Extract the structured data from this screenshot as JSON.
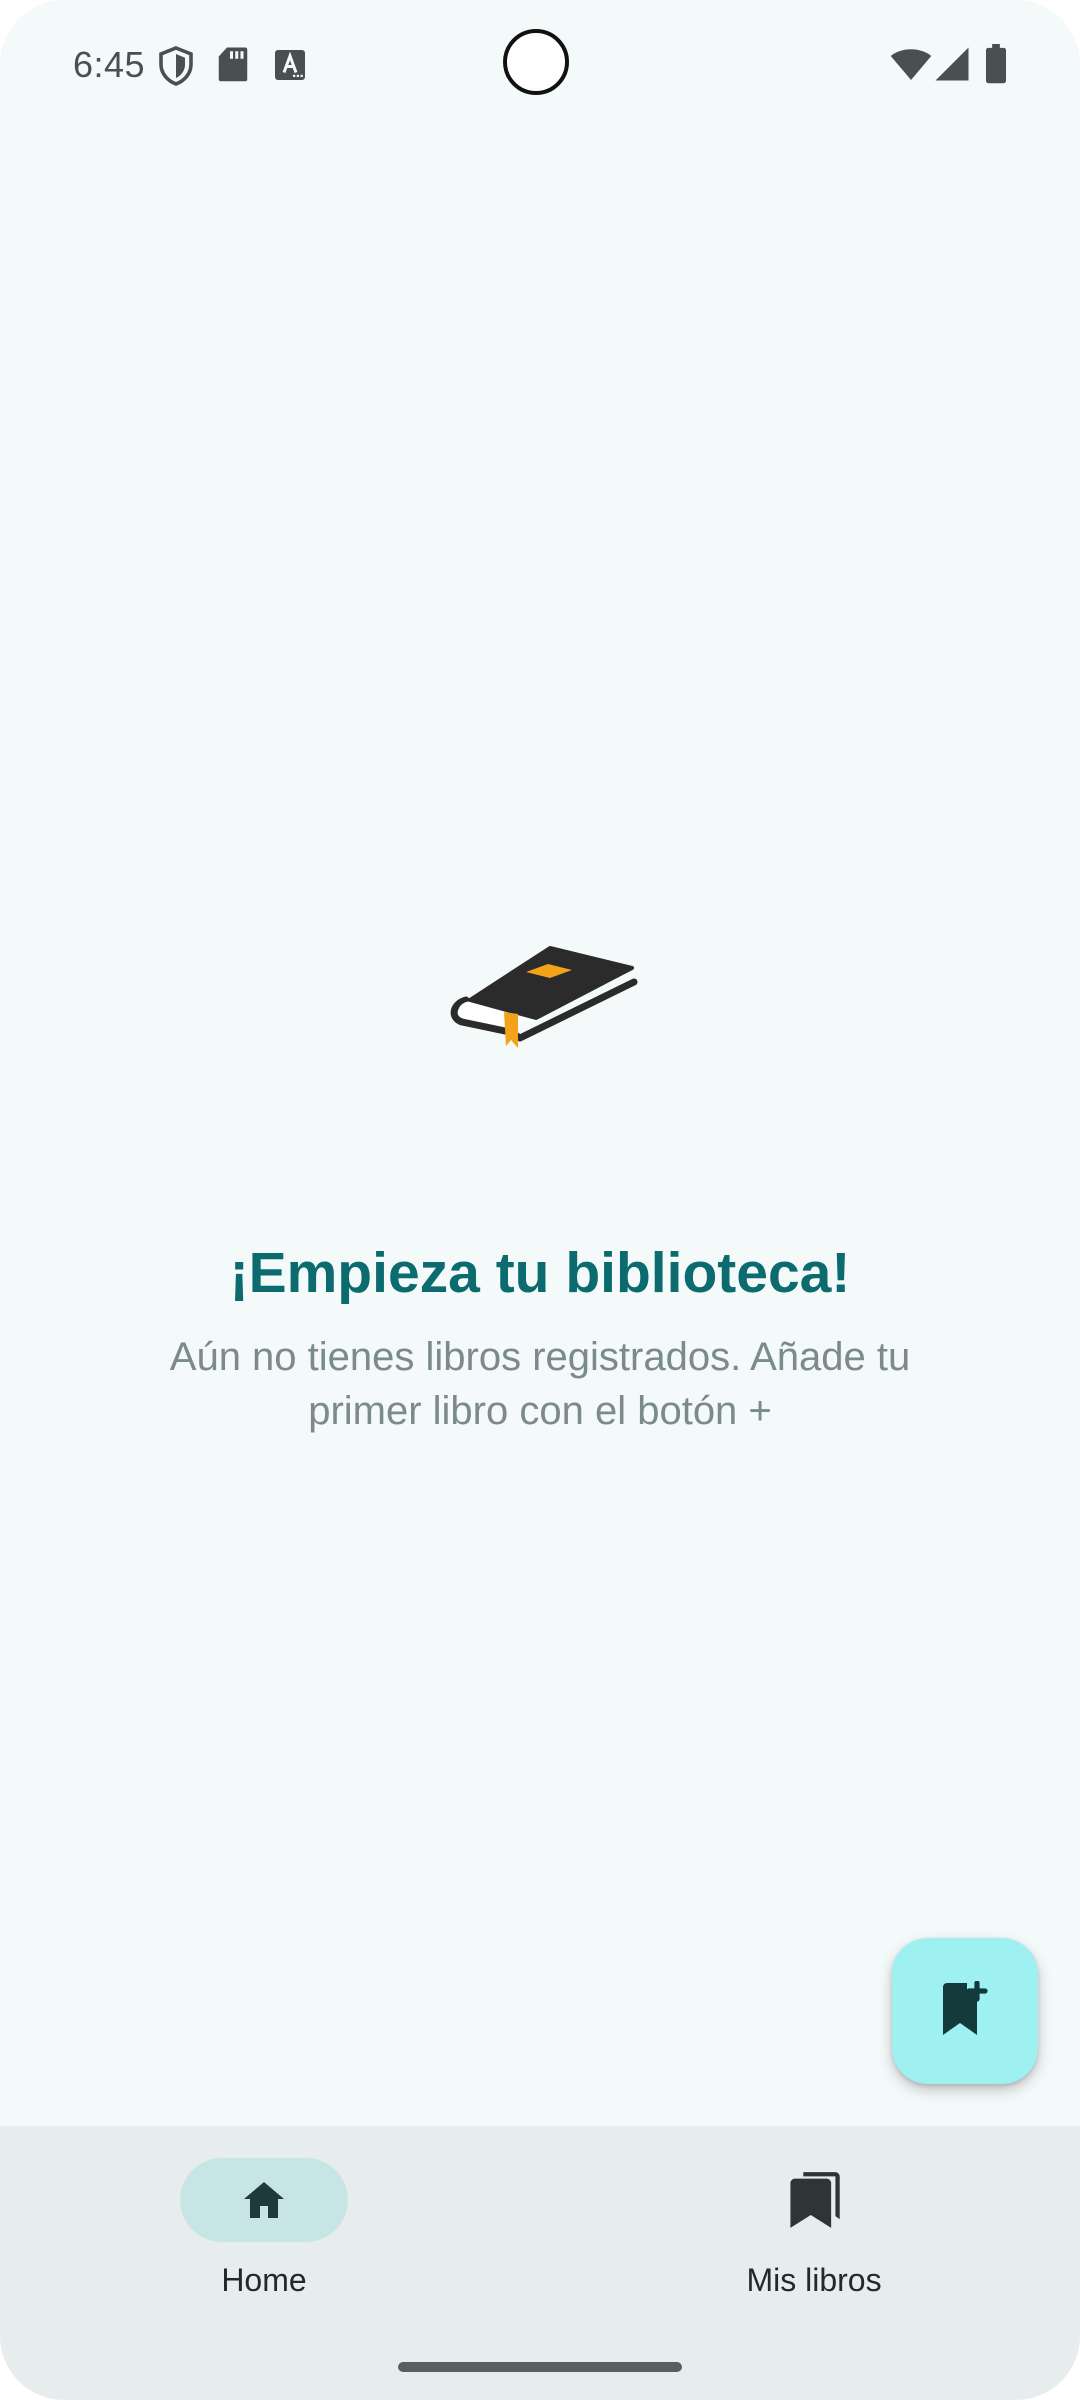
{
  "status_bar": {
    "time": "6:45",
    "left_icons": [
      "shield-icon",
      "sd-card-icon",
      "keyboard-a-icon"
    ],
    "right_icons": [
      "wifi-icon",
      "signal-icon",
      "battery-icon"
    ]
  },
  "empty_state": {
    "illustration": "book-icon",
    "title": "¡Empieza tu biblioteca!",
    "subtitle": "Aún no tienes libros registrados. Añade tu primer libro con el botón +"
  },
  "fab": {
    "icon": "bookmark-add-icon"
  },
  "bottom_nav": {
    "items": [
      {
        "label": "Home",
        "icon": "home-icon",
        "active": true
      },
      {
        "label": "Mis libros",
        "icon": "bookmarks-icon",
        "active": false
      }
    ]
  },
  "colors": {
    "background": "#f4f9f9",
    "accent_title": "#0b6b6f",
    "fab": "#9ff1f1",
    "nav_background": "#e7eded",
    "nav_active_pill": "#c8e5e6",
    "book_highlight": "#f3a21a"
  }
}
